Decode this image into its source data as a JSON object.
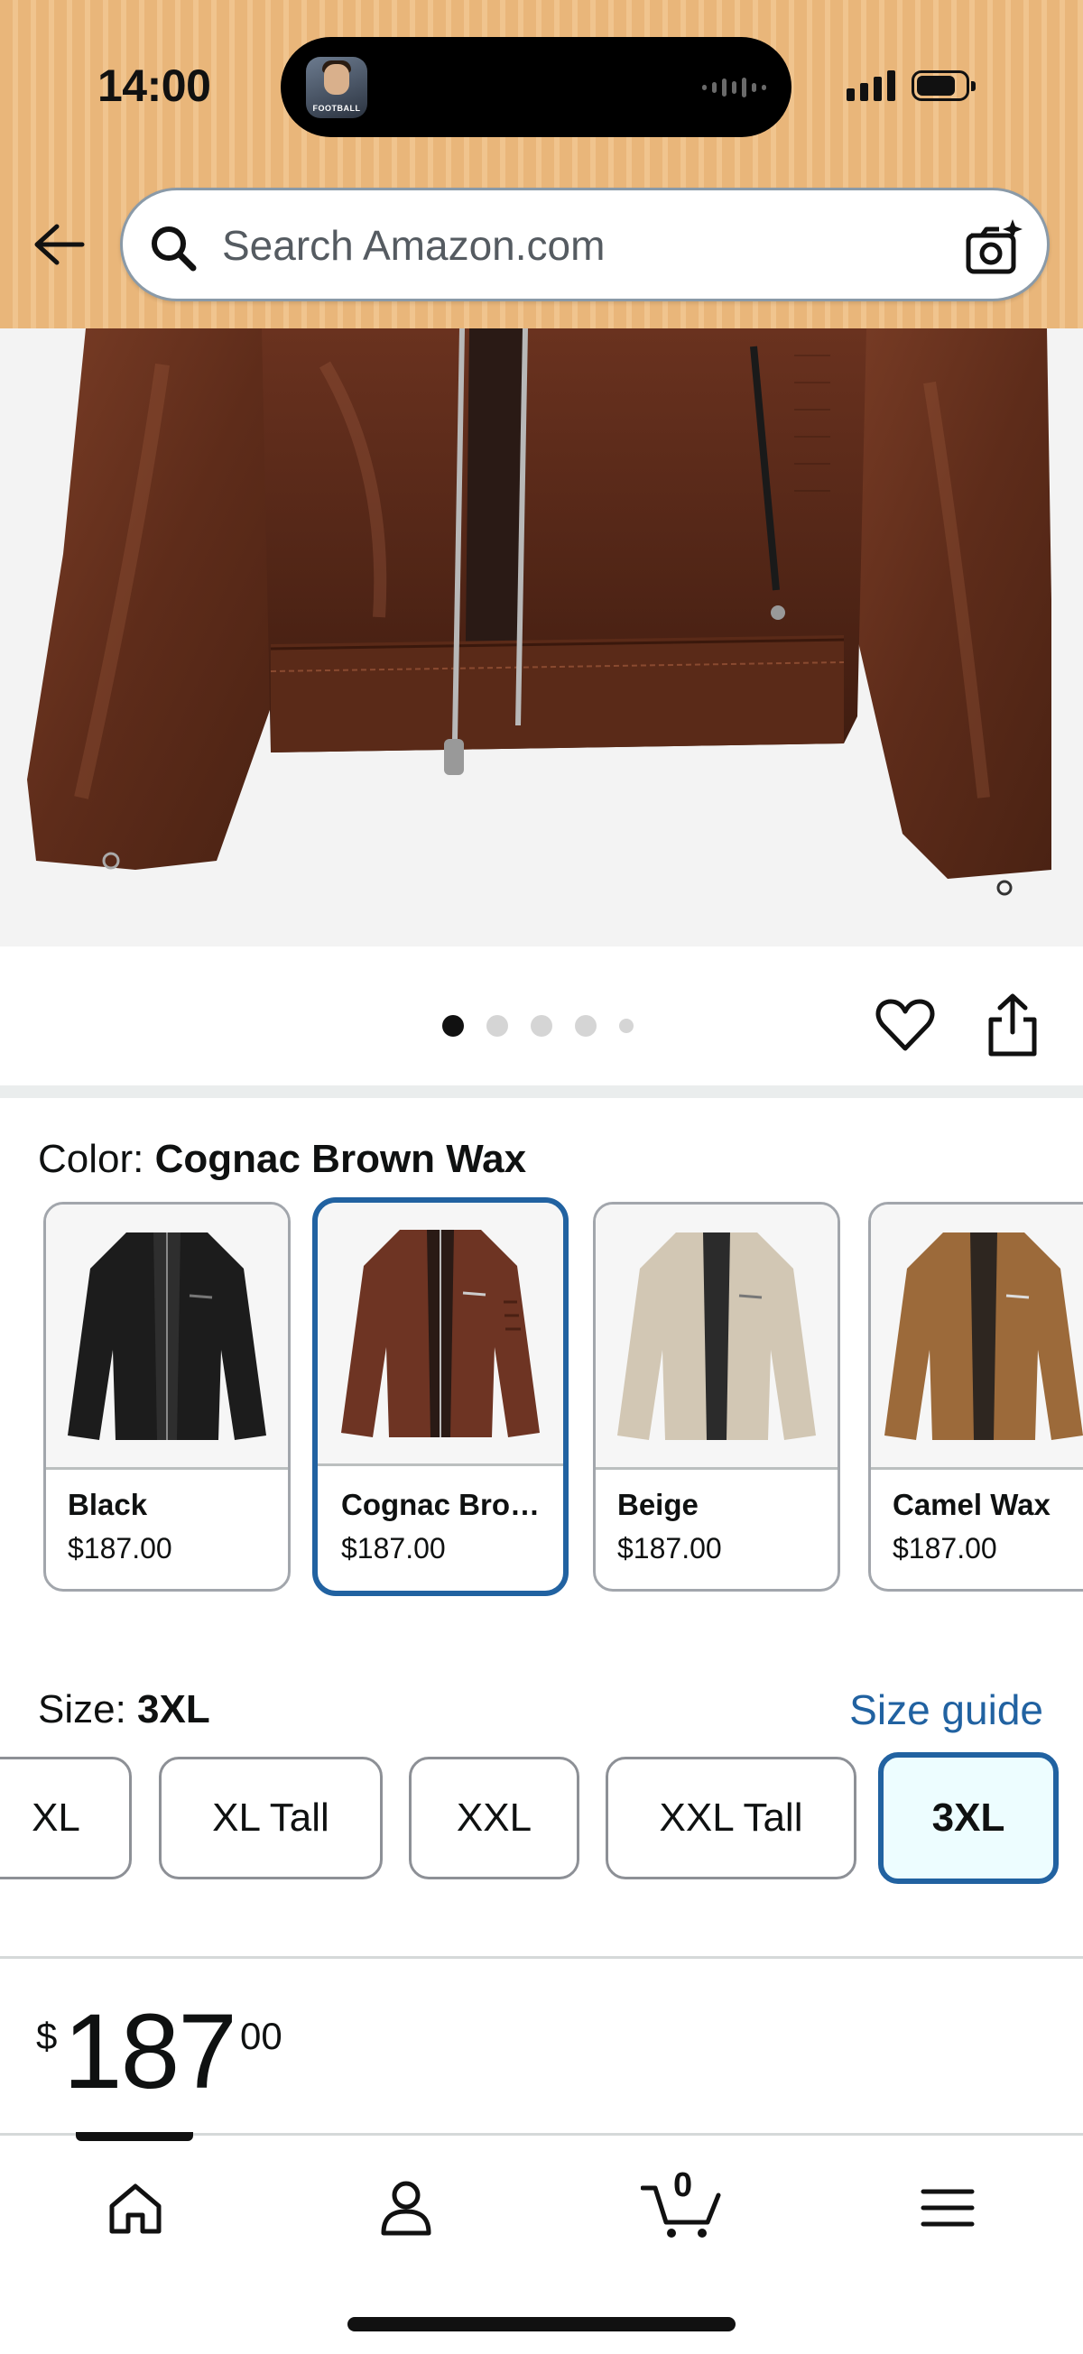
{
  "status_bar": {
    "time": "14:00",
    "island_badge": "FOOTBALL"
  },
  "header": {
    "back_icon": "arrow-left-icon",
    "search": {
      "placeholder": "Search Amazon.com",
      "value": ""
    },
    "camera_icon": "camera-sparkle-icon"
  },
  "gallery": {
    "image_count": 5,
    "active_index": 0,
    "wishlist_icon": "heart-icon",
    "share_icon": "share-icon"
  },
  "color": {
    "label": "Color: ",
    "selected": "Cognac Brown Wax",
    "options": [
      {
        "name": "Black",
        "price": "$187.00",
        "hex": "#1c1c1c"
      },
      {
        "name": "Cognac Bro…",
        "price": "$187.00",
        "hex": "#6e3423"
      },
      {
        "name": "Beige",
        "price": "$187.00",
        "hex": "#d2c7b4"
      },
      {
        "name": "Camel Wax",
        "price": "$187.00",
        "hex": "#9c6a3a"
      }
    ]
  },
  "size": {
    "label": "Size: ",
    "selected": "3XL",
    "guide_link": "Size guide",
    "options": [
      "XL",
      "XL Tall",
      "XXL",
      "XXL Tall",
      "3XL"
    ]
  },
  "price": {
    "symbol": "$",
    "whole": "187",
    "fraction": "00"
  },
  "bottom_nav": {
    "items": [
      "home-icon",
      "account-icon",
      "cart-icon",
      "menu-icon"
    ],
    "cart_count": "0"
  },
  "colors": {
    "header_bg": "#efbe85",
    "selected_border": "#2162a1",
    "link": "#2162a1",
    "selected_size_bg": "#edfdff"
  }
}
